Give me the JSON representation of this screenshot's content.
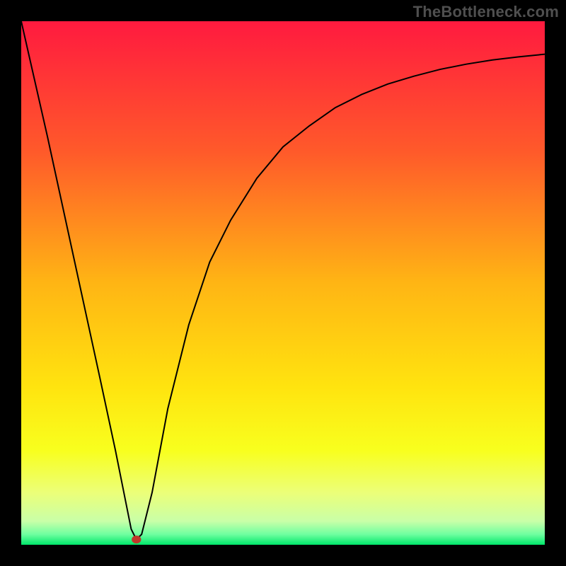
{
  "watermark": "TheBottleneck.com",
  "chart_data": {
    "type": "line",
    "title": "",
    "xlabel": "",
    "ylabel": "",
    "xlim": [
      0,
      100
    ],
    "ylim": [
      0,
      100
    ],
    "grid": false,
    "background_gradient": {
      "orientation": "vertical",
      "stops": [
        {
          "offset": 0.0,
          "color": "#ff1a3f"
        },
        {
          "offset": 0.25,
          "color": "#ff5a2a"
        },
        {
          "offset": 0.5,
          "color": "#ffb514"
        },
        {
          "offset": 0.7,
          "color": "#ffe40f"
        },
        {
          "offset": 0.82,
          "color": "#f8ff1e"
        },
        {
          "offset": 0.9,
          "color": "#ecff78"
        },
        {
          "offset": 0.955,
          "color": "#c9ffa8"
        },
        {
          "offset": 0.98,
          "color": "#6fffa0"
        },
        {
          "offset": 1.0,
          "color": "#00e76a"
        }
      ]
    },
    "series": [
      {
        "name": "bottleneck-curve",
        "color": "#000000",
        "x": [
          0,
          5,
          10,
          15,
          18,
          20,
          21,
          22,
          23,
          25,
          28,
          32,
          36,
          40,
          45,
          50,
          55,
          60,
          65,
          70,
          75,
          80,
          85,
          90,
          95,
          100
        ],
        "y": [
          100,
          78,
          55,
          32,
          18,
          8,
          3,
          1,
          2,
          10,
          26,
          42,
          54,
          62,
          70,
          76,
          80,
          83.5,
          86,
          88,
          89.5,
          90.8,
          91.8,
          92.6,
          93.2,
          93.7
        ]
      }
    ],
    "marker": {
      "x": 22,
      "y": 1,
      "color": "#c0392b",
      "radius": 6
    }
  }
}
